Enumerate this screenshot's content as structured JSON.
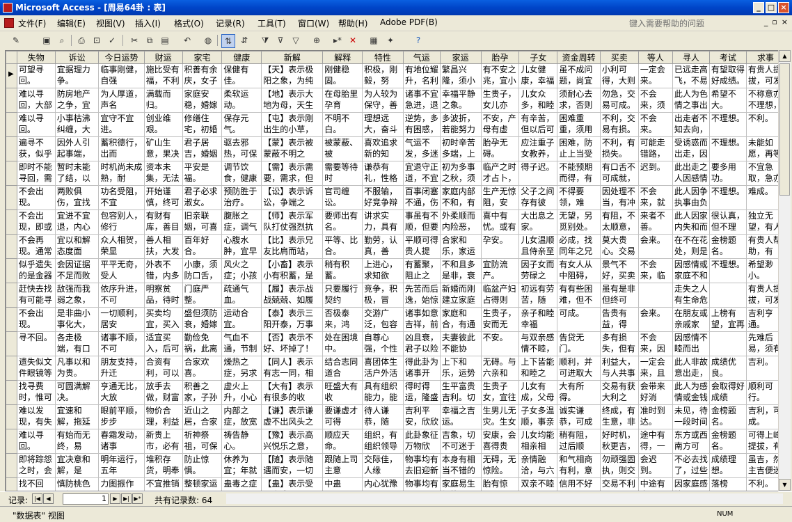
{
  "window": {
    "title": "Microsoft Access - [周易64卦 : 表]"
  },
  "menu": [
    "文件(F)",
    "编辑(E)",
    "视图(V)",
    "插入(I)",
    "格式(O)",
    "记录(R)",
    "工具(T)",
    "窗口(W)",
    "帮助(H)",
    "Adobe PDF(B)"
  ],
  "help_placeholder": "键入需要帮助的问题",
  "columns": [
    "失物",
    "诉讼",
    "今日运势",
    "财运",
    "家宅",
    "健康",
    "新解",
    "解释",
    "特性",
    "气运",
    "家运",
    "胎孕",
    "子女",
    "资金周转",
    "买卖",
    "等人",
    "寻人",
    "考试",
    "求事"
  ],
  "rows": [
    [
      "可望寻回。",
      "宜据理力争。",
      "临事刚健，自强",
      "施比受有福，不利",
      "积善有余庆，女子",
      "保健有佳。",
      "【天】表示极阳之象，为纯卦",
      "刚健稳固。",
      "积极，刚毅，努",
      "有地位耀升，名利",
      "繁昌兴隆，须小心",
      "有不安之兆，宜小",
      "儿女健康，幸福",
      "虽不成问题，尚宜",
      "小利可得，大则",
      "一定会来。",
      "已远走高飞，不易",
      "有望取得好成绩。",
      "有贵人提拔，可发"
    ],
    [
      "难以寻回，大部",
      "防房地产之争，宜",
      "为人厚道，声名",
      "满载而归。",
      "家庭安稳，婚嫁",
      "柔软运动。",
      "【地】表示大地为母，天生之母",
      "在母胎里孕育",
      "为人较为保守，善",
      "诸事不宜急进，退",
      "幸福平静之象。",
      "生贵子，女儿亦",
      "儿女众多，和睦",
      "须耐心去求，否则",
      "勿急，交易可成。",
      "不会来，须再待些",
      "此人为色情之事出",
      "希望不大。",
      "不称意亦不理想，只"
    ],
    [
      "难以寻回。",
      "小事枯沸纠缠，大",
      "宜守不宜进。",
      "创业维艰。",
      "修缮住宅，初婚",
      "保存元气。",
      "【屯】表示刚出生的小草，主凶",
      "不明不白。",
      "理想远大，奋斗",
      "逆势，多有困惑，",
      "多波折，若能努力",
      "不安，产母有虚",
      "有辛苦，但以后可",
      "困难重重，须用",
      "不利，交易有损。",
      "不会来。",
      "出走者不知去向，",
      "不理想。",
      "不利。"
    ],
    [
      "遍寻不获，似乎",
      "因外人引起事端，",
      "蓄积德行，出而",
      "矿山生意，果决",
      "君子居吉，婚姻",
      "驱去邪热，可保",
      "【蒙】表示被蒙蔽不明之意。主",
      "被蒙蔽、被",
      "喜欢追求新的知",
      "气运不发，多迷",
      "初时辛苦多端，上",
      "胎孕无碍。",
      "应注重子女教养，",
      "困难，防止上当受",
      "不利，有损失。",
      "可能走错路，会迟",
      "受诱惑而出走，因",
      "不理想。",
      "未能如愿，再等"
    ],
    [
      "即时不能寻回，需",
      "暂时未能了结，以",
      "时机尚未成熟，耐",
      "资本未集，无法",
      "平安是福。",
      "调节饮食，健康",
      "【需】表示需要，需求，但却",
      "需要等待时",
      "谦恭有礼，性格",
      "宜退守正道，不宜",
      "初为多事之秋，须",
      "临产之时才占卜，",
      "得子迟。",
      "不能预期而得，有",
      "有口舌不可成就，",
      "迟到。",
      "此出走之人因感情",
      "要多用功。",
      "不宜急取，急亦"
    ],
    [
      "不会出现。",
      "两败俱伤，宜找",
      "功名受阻，不宜",
      "开始谨慎，终可",
      "君子必求淑女。",
      "预防胜于治疗。",
      "【讼】表示诉讼，争端之象。",
      "官司缠讼。",
      "不服输，好竞争辩",
      "百事闭塞不通，伤",
      "家庭内部不和，有",
      "生产无惊阻，安",
      "父子之间存有彼",
      "不得要领，难",
      "因处理不当，有冲",
      "不会来，就算会",
      "此人因争执事由负",
      "不理想。",
      "难成。"
    ],
    [
      "不会出现，即或",
      "宜进不宜退，内心",
      "包容别人，修行",
      "有财有库，善目",
      "旧亲联姻，可喜",
      "腹胀之症，调气",
      "【师】表示军队打仗强烈抗争之",
      "要师出有名。",
      "讲求实力，具有",
      "事虽有不顺，但要",
      "外柔顺而内险恶，",
      "喜中有忧。或有",
      "大出息之家。",
      "无望，另觅别处。",
      "有阻，不太顺意，",
      "来者不善。",
      "此人因家内失和而",
      "很认真，但不理",
      "独立无望，有人"
    ],
    [
      "不会再现。通常",
      "宜以和解态度面",
      "众人相贺，荣显",
      "善人相扶，大发",
      "百年好合。",
      "心腹水肿，宜早",
      "【比】表示兄友比肩而站，一片",
      "平等、比合。",
      "勤劳，认真，善",
      "平顺可得贵人提",
      "合家和乐，家运",
      "孕安。",
      "儿女温顺且侍亲至",
      "必成，找同年之兄",
      "莫大贵心。交易",
      "会来。",
      "在不在花处，则是",
      "金榜题名。",
      "有贵人帮助，有"
    ],
    [
      "似乎遗失的是金器",
      "会因证据不足而败",
      "平平无奇，受人",
      "外表不错，内多",
      "小康，须防口舌，",
      "风火之症；小孩",
      "【小畜】表示小有积蓄，是个小",
      "稍有积蓄。",
      "上进心，求知欲",
      "有蓄聚，阻止之",
      "不和且多是非，衰",
      "宜防流产。",
      "因子女而劳碌之",
      "有女人从中阻碍，",
      "景气不好，买卖",
      "不会来，临时变",
      "因感情或家庭不和",
      "不理想。",
      "希望渺小。"
    ],
    [
      "赶快去找有可能寻",
      "敌强而我弱之象，",
      "依序升进，不可",
      "明察贫品，待时",
      "门庭严整。",
      "疏通气血。",
      "【履】表示战战兢兢、如履薄冰",
      "只要履行契约",
      "竞争，积极，冒",
      "先苦而后逸，始惊",
      "新婚而刚建立家庭",
      "临盆产妇占得则",
      "初远有劳苦，随",
      "有有些困难，但不",
      "虽有是非但终可",
      "",
      "走失之人有生命危",
      "",
      "有贵人提拔，可发"
    ],
    [
      "不会出现。",
      "是非曲小事化大，",
      "一切顺利，居安",
      "买卖均宜，买入",
      "盛但须防衰，婚嫁",
      "运动合宜。",
      "【泰】表示三阳开泰，万事亨",
      "否极泰来，鸿",
      "交游广泛，包容",
      "诸事如意吉祥，前",
      "家庭和合，有通",
      "生贵子，安而无",
      "亲子和睦幸福",
      "可成。",
      "告贵有益，得",
      "会来。",
      "在朋友或亲戚家",
      "上榜有望，宜再",
      "吉利亨通。"
    ],
    [
      "寻不回。",
      "各走极端，有口",
      "诸事不顺，不可",
      "适宜买入，后可",
      "勤俭免祸，此离",
      "气血不通，节制",
      "【否】表示不好、坏掉了！",
      "处在困境中。",
      "自尊心强，个性",
      "凶且衰，君子以险",
      "夫妻彼此不能协",
      "不安。",
      "与双亲感情不睦，",
      "告贷无门。",
      "多有损失，但有",
      "不会来，因别的事",
      "因感情不睦而出",
      "",
      "先难后易，须有"
    ],
    [
      "遗失似文件眼镜等",
      "凡事以和为贵。",
      "朋友支持，升迁",
      "合资有利，可以",
      "合家欢喜。",
      "燥热之症，另求",
      "【同人】表示有志一同，相和而",
      "结合志同道合",
      "喜团体生活户外活",
      "得此卦为诸事开",
      "上下和乐，运势",
      "无碍。与六亲和",
      "上下皆能和睦之",
      "顺利，并可进取大",
      "利益大，与人共事",
      "一定会来，且会",
      "此人非故意出走，",
      "成绩优良。",
      "吉利。"
    ],
    [
      "找寻费时，惟可",
      "可圆满解决。",
      "亨通无比，大放",
      "放手去做，财富",
      "积善之家，子孙",
      "虚火上升，小心",
      "【大有】表示有很多的收获，是",
      "旺盛大有收",
      "具有组织能力，能",
      "得时得运，隆盛",
      "生平富贵吉利。切",
      "生贵子女，宜往",
      "儿女有成，父母",
      "大有所得。",
      "交易有获大利之",
      "会带来好消息。",
      "此人为感情或金钱",
      "会取得好成绩",
      "顺利可行。"
    ],
    [
      "难以发现，有失",
      "宜速和解，拖延",
      "眼前平顺，步步",
      "物价合理，利益",
      "近山之居，合家",
      "内部之症，放宽",
      "【谦】表示谦虚不出风头之意。",
      "要谦虚才可得",
      "待人谦恭，随",
      "吉利平安，欣欣",
      "幸福之吉运。",
      "生男儿无灾。生女",
      "子女多温顺，事亲",
      "诚实谦恭，可成",
      "终成，有生意，非",
      "准时到达。",
      "未见，待一段时间",
      "金榜题名。",
      "吉利，可成。"
    ],
    [
      "难以寻回。",
      "有始而无终，易",
      "春霜发动，诸事",
      "新贵上市，必有",
      "祈神祭祖，可保",
      "祷告静心。",
      "【豫】表示高兴悦乐之意，主小",
      "顺应天命。",
      "组织，有组织领导",
      "此卦象征万物欣",
      "吉象，切不可迷于",
      "安康，会喜得贵",
      "儿女均能相亲相",
      "稍有阻，过后顺",
      "好时机，秋更吉，",
      "途中有得，一定",
      "东方或西南方可",
      "金榜题名。",
      "可得上峰提拔，有"
    ],
    [
      "即将踪怨之时，会",
      "宜决意和解，是",
      "明年运行，五年",
      "堆积存货，明奉",
      "防止惊惧。",
      "休养为宜；年就",
      "【随】表示随遇而安，一切随",
      "跟随上司主意",
      "交际佳，人缘",
      "物事均有去旧迎新",
      "本身有相当不错的",
      "无碍，无惊险。",
      "亲情融洽，与六",
      "和气相商有利，意",
      "勿顽强固执，则交",
      "会迟到。",
      "不必去找了，过些",
      "成绩理想。",
      "虽吉，然主吉便迷"
    ],
    [
      "找不回",
      "慎防桃色纠纷",
      "力图振作",
      "不宜推销",
      "整顿家运",
      "蛊毒之症",
      "【蛊】表示受到蛊惑",
      "中蛊",
      "内心犹豫",
      "物事均有败坏",
      "家庭易生纷扰",
      "胎有惊",
      "双亲不睦",
      "信用不好",
      "交易不利",
      "中途有变",
      "因家庭感情",
      "落榜",
      "不利。"
    ]
  ],
  "nav": {
    "label": "记录:",
    "current": "1",
    "count_label": "共有记录数: 64"
  },
  "status": {
    "text": "\"数据表\" 视图",
    "num": "NUM"
  }
}
